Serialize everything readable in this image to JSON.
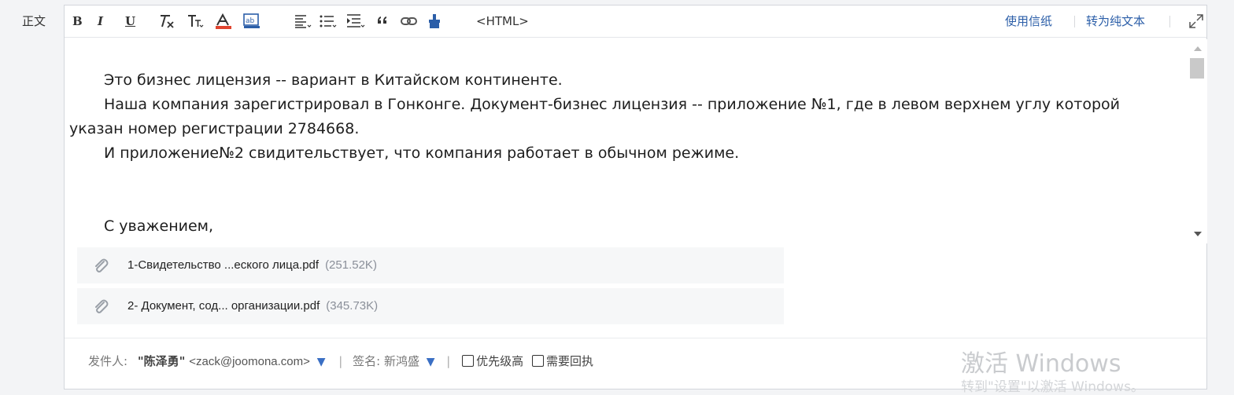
{
  "field_label": "正文",
  "toolbar": {
    "buttons": [
      {
        "name": "bold-button",
        "label": "B"
      },
      {
        "name": "italic-button",
        "label": "I"
      },
      {
        "name": "underline-button",
        "label": "U"
      },
      {
        "name": "clear-format-button",
        "icon": "clear-format-icon"
      },
      {
        "name": "font-size-button",
        "icon": "font-size-icon"
      },
      {
        "name": "font-color-button",
        "icon": "font-color-icon"
      },
      {
        "name": "background-color-button",
        "icon": "background-color-icon"
      },
      {
        "name": "align-button",
        "icon": "align-left-icon"
      },
      {
        "name": "list-button",
        "icon": "list-icon"
      },
      {
        "name": "indent-button",
        "icon": "indent-icon"
      },
      {
        "name": "quote-button",
        "icon": "quote-icon"
      },
      {
        "name": "link-button",
        "icon": "link-icon"
      },
      {
        "name": "format-painter-button",
        "icon": "brush-icon"
      }
    ],
    "html_label": "<HTML>",
    "use_stationery": "使用信纸",
    "to_plain_text": "转为纯文本",
    "accent_color": "#2b5ea8"
  },
  "body": {
    "lines": [
      "Это бизнес лицензия -- вариант в Китайском континенте.",
      "Наша компания зарегистрировал в Гонконге. Документ-бизнес лицензия -- приложение №1, где в левом верхнем углу которой указан номер регистрации 2784668.",
      "И приложение№2 свидительствует, что компания работает в обычном режиме.",
      "",
      "",
      "С уважением,"
    ]
  },
  "attachments": [
    {
      "name": "1-Свидетельство ...еского лица.pdf",
      "size": "(251.52K)"
    },
    {
      "name": "2- Документ, сод... организации.pdf",
      "size": "(345.73K)"
    }
  ],
  "footer": {
    "sender_label": "发件人:",
    "sender_name": "\"陈泽勇\"",
    "sender_email": "<zack@joomona.com>",
    "signature_label": "签名:",
    "signature_value": "新鸿盛",
    "priority_label": "优先级高",
    "receipt_label": "需要回执"
  },
  "watermark": {
    "line1": "激活 Windows",
    "line2": "转到\"设置\"以激活 Windows。"
  }
}
